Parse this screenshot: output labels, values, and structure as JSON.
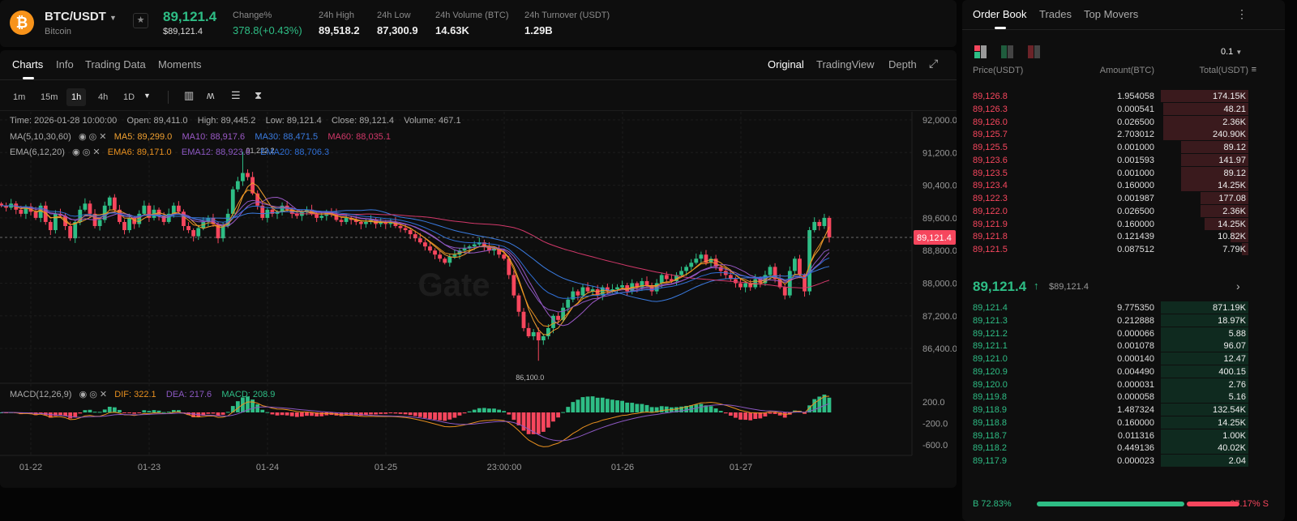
{
  "header": {
    "pair": "BTC/USDT",
    "coin_name": "Bitcoin",
    "last_price": "89,121.4",
    "last_price_usd": "$89,121.4",
    "stats": [
      {
        "label": "Change%",
        "value": "378.8(+0.43%)",
        "color": "#2ebd85"
      },
      {
        "label": "24h High",
        "value": "89,518.2"
      },
      {
        "label": "24h Low",
        "value": "87,300.9"
      },
      {
        "label": "24h Volume (BTC)",
        "value": "14.63K"
      },
      {
        "label": "24h Turnover (USDT)",
        "value": "1.29B"
      }
    ]
  },
  "chart_tabs": {
    "left": [
      "Charts",
      "Info",
      "Trading Data",
      "Moments"
    ],
    "active": "Charts",
    "right": [
      "Original",
      "TradingView",
      "Depth"
    ],
    "right_active": "Original"
  },
  "timeframes": {
    "items": [
      "1m",
      "15m",
      "1h",
      "4h",
      "1D"
    ],
    "active": "1h"
  },
  "info_line": {
    "time": "Time: 2026-01-28 10:00:00",
    "open": "Open: 89,411.0",
    "high": "High: 89,445.2",
    "low": "Low: 89,121.4",
    "close": "Close: 89,121.4",
    "volume": "Volume: 467.1"
  },
  "ma_legend": {
    "title": "MA(5,10,30,60)",
    "items": [
      {
        "text": "MA5: 89,299.0",
        "color": "#f0a030"
      },
      {
        "text": "MA10: 88,917.6",
        "color": "#9b59c6"
      },
      {
        "text": "MA30: 88,471.5",
        "color": "#3a7be0"
      },
      {
        "text": "MA60: 88,035.1",
        "color": "#d2386a"
      }
    ]
  },
  "ema_legend": {
    "title": "EMA(6,12,20)",
    "items": [
      {
        "text": "EMA6: 89,171.0",
        "color": "#e8901f"
      },
      {
        "text": "EMA12: 88,923.6",
        "color": "#8c58c2"
      },
      {
        "text": "EMA20: 88,706.3",
        "color": "#2f6fd6"
      }
    ]
  },
  "macd_legend": {
    "title": "MACD(12,26,9)",
    "items": [
      {
        "text": "DIF: 322.1",
        "color": "#e8901f"
      },
      {
        "text": "DEA: 217.6",
        "color": "#8c58c2"
      },
      {
        "text": "MACD: 208.9",
        "color": "#2ebd85"
      }
    ]
  },
  "watermark": "Gate",
  "chart_data": {
    "type": "candlestick",
    "up_color": "#2ebd85",
    "down_color": "#f6465d",
    "y_ticks": [
      "92,000.0",
      "91,200.0",
      "90,400.0",
      "89,600.0",
      "88,800.0",
      "88,000.0",
      "87,200.0",
      "86,400.0"
    ],
    "ylim": [
      86400,
      92000
    ],
    "x_ticks": [
      "01-22",
      "01-23",
      "01-24",
      "01-25",
      "23:00:00",
      "01-26",
      "01-27"
    ],
    "current_price_label": "89,121.4",
    "max_label": "91,222.2",
    "max_value": 91222.2,
    "min_label": "86,100.0",
    "min_value": 86100.0,
    "closes": [
      89900,
      89850,
      89950,
      89800,
      89700,
      89880,
      89750,
      89600,
      89900,
      89500,
      89300,
      89700,
      89650,
      89400,
      89100,
      89500,
      89800,
      89950,
      89700,
      89400,
      89550,
      89900,
      90100,
      89800,
      89500,
      89300,
      89600,
      89450,
      89700,
      89900,
      89600,
      89800,
      89650,
      89500,
      89700,
      89900,
      89750,
      89400,
      89300,
      89150,
      89350,
      89500,
      89600,
      89450,
      89100,
      89400,
      89700,
      90300,
      90500,
      90700,
      90600,
      90200,
      89900,
      89600,
      89800,
      89700,
      89750,
      89900,
      89800,
      89700,
      89650,
      89750,
      89800,
      89700,
      89600,
      89650,
      89750,
      89700,
      89550,
      89500,
      89600,
      89550,
      89500,
      89450,
      89500,
      89550,
      89450,
      89500,
      89450,
      89500,
      89400,
      89350,
      89300,
      89200,
      89100,
      89000,
      88900,
      88800,
      88700,
      88600,
      88500,
      88650,
      88700,
      88800,
      88850,
      88900,
      88950,
      89000,
      88900,
      88800,
      88850,
      88700,
      88600,
      88200,
      87700,
      87300,
      86900,
      86700,
      86800,
      86600,
      86700,
      86900,
      87200,
      87100,
      87400,
      87600,
      87800,
      87700,
      87900,
      87800,
      87850,
      87700,
      87900,
      87800,
      87850,
      87900,
      87950,
      87800,
      88000,
      87900,
      88050,
      87950,
      87800,
      88000,
      88200,
      88100,
      88050,
      88200,
      88300,
      88400,
      88500,
      88600,
      88700,
      88500,
      88600,
      88400,
      88300,
      88200,
      88100,
      88000,
      87900,
      88000,
      87900,
      88100,
      88000,
      88200,
      88400,
      88100,
      87900,
      87700,
      88300,
      88600,
      88200,
      87800,
      89300,
      89500,
      89400,
      89600,
      89121.4
    ],
    "macd_ticks": [
      "200.0",
      "-200.0",
      "-600.0"
    ],
    "ma_colors": {
      "MA5": "#f0a030",
      "MA10": "#9b59c6",
      "MA30": "#3a7be0",
      "MA60": "#d2386a",
      "EMA6": "#e8901f",
      "EMA12": "#8c58c2",
      "EMA20": "#2f6fd6"
    }
  },
  "order_book": {
    "tabs": [
      "Order Book",
      "Trades",
      "Top Movers"
    ],
    "active_tab": "Order Book",
    "precision": "0.1",
    "columns": [
      "Price(USDT)",
      "Amount(BTC)",
      "Total(USDT)"
    ],
    "asks": [
      [
        "89,126.8",
        "1.954058",
        "174.15K"
      ],
      [
        "89,126.3",
        "0.000541",
        "48.21"
      ],
      [
        "89,126.0",
        "0.026500",
        "2.36K"
      ],
      [
        "89,125.7",
        "2.703012",
        "240.90K"
      ],
      [
        "89,125.5",
        "0.001000",
        "89.12"
      ],
      [
        "89,123.6",
        "0.001593",
        "141.97"
      ],
      [
        "89,123.5",
        "0.001000",
        "89.12"
      ],
      [
        "89,123.4",
        "0.160000",
        "14.25K"
      ],
      [
        "89,122.3",
        "0.001987",
        "177.08"
      ],
      [
        "89,122.0",
        "0.026500",
        "2.36K"
      ],
      [
        "89,121.9",
        "0.160000",
        "14.25K"
      ],
      [
        "89,121.8",
        "0.121439",
        "10.82K"
      ],
      [
        "89,121.5",
        "0.087512",
        "7.79K"
      ]
    ],
    "ask_depth": [
      1,
      0.97,
      0.97,
      0.97,
      0.77,
      0.77,
      0.77,
      0.77,
      0.55,
      0.55,
      0.5,
      0.2,
      0.07
    ],
    "mid_price": "89,121.4",
    "mid_usd": "$89,121.4",
    "bids": [
      [
        "89,121.4",
        "9.775350",
        "871.19K"
      ],
      [
        "89,121.3",
        "0.212888",
        "18.97K"
      ],
      [
        "89,121.2",
        "0.000066",
        "5.88"
      ],
      [
        "89,121.1",
        "0.001078",
        "96.07"
      ],
      [
        "89,121.0",
        "0.000140",
        "12.47"
      ],
      [
        "89,120.9",
        "0.004490",
        "400.15"
      ],
      [
        "89,120.0",
        "0.000031",
        "2.76"
      ],
      [
        "89,119.8",
        "0.000058",
        "5.16"
      ],
      [
        "89,118.9",
        "1.487324",
        "132.54K"
      ],
      [
        "89,118.8",
        "0.160000",
        "14.25K"
      ],
      [
        "89,118.7",
        "0.011316",
        "1.00K"
      ],
      [
        "89,118.2",
        "0.449136",
        "40.02K"
      ],
      [
        "89,117.9",
        "0.000023",
        "2.04"
      ]
    ],
    "bid_depth": [
      1,
      1,
      1,
      1,
      1,
      1,
      1,
      1,
      1,
      1,
      1,
      1,
      1
    ],
    "buy_ratio": "B 72.83%",
    "sell_ratio": "27.17% S",
    "buy_fraction": 0.7283
  }
}
